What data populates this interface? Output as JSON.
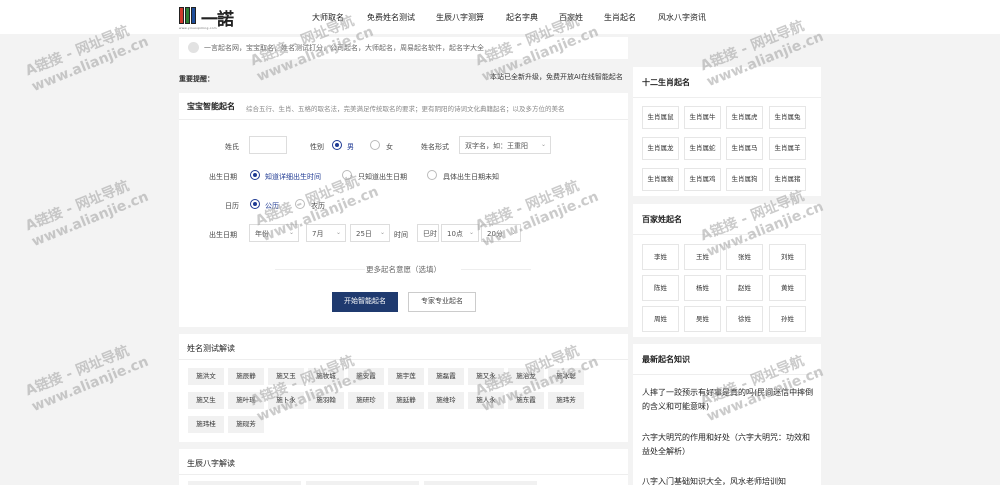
{
  "header": {
    "logo_mark": "一諾",
    "logo_sub": "www.yinuoqiming.com",
    "nav": [
      "大师取名",
      "免费姓名测试",
      "生辰八字测算",
      "起名字典",
      "百家姓",
      "生肖起名",
      "风水八字资讯"
    ]
  },
  "breadcrumb": {
    "text": "一言起名网，宝宝取名，姓名测试打分，公司起名，大师起名，周易起名软件，起名字大全"
  },
  "notice": {
    "label": "重要提醒：",
    "text": "本站已全新升级，免费开放AI在线智能起名"
  },
  "form": {
    "title": "宝宝智能起名",
    "description": "综合五行、生肖、五格的取名法，完美满足传统取名的要求；更有阴阳的诗词文化典籍起名；以及多方位的美名",
    "surname_label": "姓氏",
    "surname_value": "",
    "gender_label": "性别",
    "gender_options": [
      "男",
      "女"
    ],
    "name_form_label": "姓名形式",
    "name_form_value": "双字名，如：王重阳",
    "birth_label": "出生日期",
    "birth_options": [
      "知道详细出生时间",
      "只知道出生日期",
      "具体出生日期未知"
    ],
    "calendar_label": "日历",
    "calendar_options": [
      "公历",
      "农历"
    ],
    "date_label": "出生日期",
    "year_value": "年份",
    "month_value": "7月",
    "day_value": "25日",
    "time_label": "时间",
    "hour_value": "巳时",
    "hour_sub_value": "10点",
    "minute_value": "20分",
    "more_options": "更多起名意愿（选填）",
    "submit_label": "开始智能起名",
    "expert_label": "专家专业起名"
  },
  "name_test": {
    "title": "姓名测试解读",
    "tags": [
      "施洪文",
      "施辰静",
      "施又玉",
      "施牧城",
      "施安霞",
      "施宇莲",
      "施磊霞",
      "施又永",
      "施治龙",
      "施冰聪",
      "施又生",
      "施叶瑶",
      "施卜永",
      "施羽翰",
      "施研珍",
      "施延静",
      "施维玲",
      "施人永",
      "施东霞",
      "施玮芳",
      "施玮桂",
      "施砚芳"
    ]
  },
  "bazi": {
    "title": "生辰八字解读"
  },
  "sidebar": {
    "zodiac_title": "十二生肖起名",
    "zodiac": [
      "生肖属鼠",
      "生肖属牛",
      "生肖属虎",
      "生肖属兔",
      "生肖属龙",
      "生肖属蛇",
      "生肖属马",
      "生肖属羊",
      "生肖属猴",
      "生肖属鸡",
      "生肖属狗",
      "生肖属猪"
    ],
    "surname_title": "百家姓起名",
    "surnames": [
      "李姓",
      "王姓",
      "张姓",
      "刘姓",
      "陈姓",
      "杨姓",
      "赵姓",
      "黄姓",
      "周姓",
      "吴姓",
      "徐姓",
      "孙姓"
    ],
    "news_title": "最新起名知识",
    "news": [
      "人摔了一跤预示有好事是真的吗(民间迷信中摔倒的含义和可能意味)",
      "六字大明咒的作用和好处（六字大明咒：功效和益处全解析）",
      "八字入门基础知识大全，风水老师培训知"
    ]
  },
  "watermark": {
    "line1": "A链接 - 网址导航",
    "line2": "www.alianjie.cn"
  }
}
